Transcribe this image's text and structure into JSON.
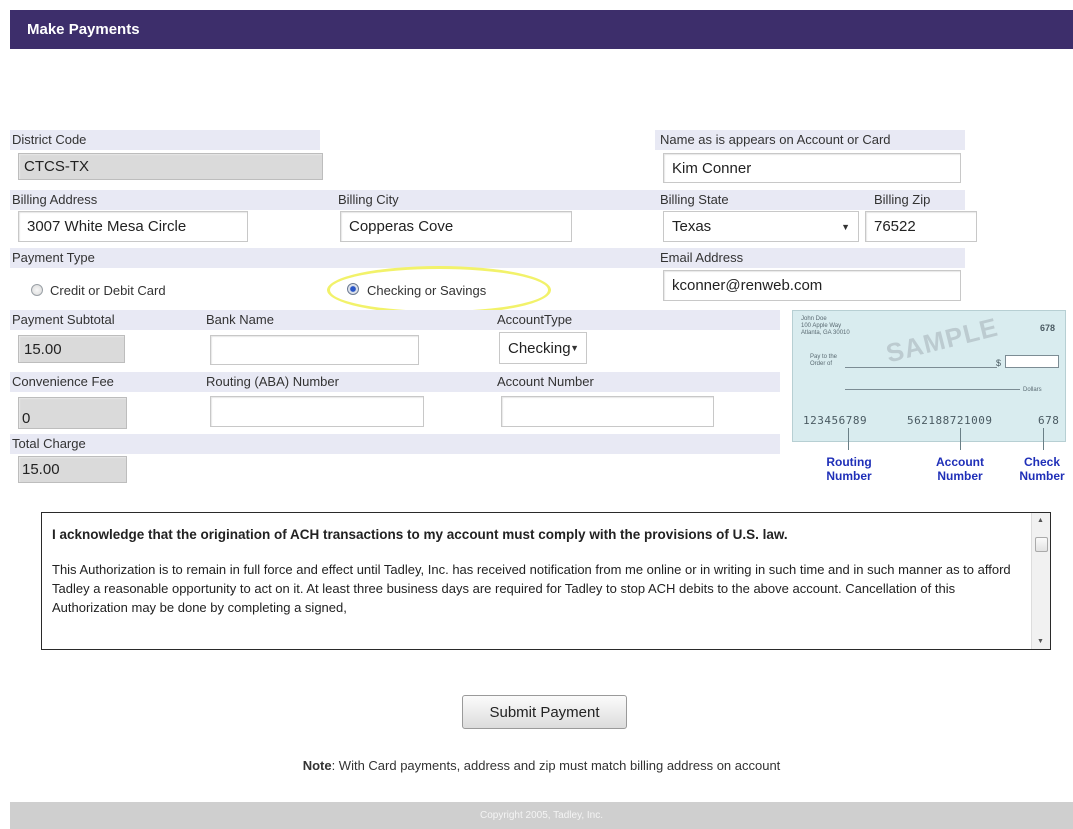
{
  "header": {
    "title": "Make Payments"
  },
  "labels": {
    "district_code": "District Code",
    "name_on_account": "Name as is appears on Account or Card",
    "billing_address": "Billing Address",
    "billing_city": "Billing City",
    "billing_state": "Billing State",
    "billing_zip": "Billing Zip",
    "payment_type": "Payment Type",
    "email_address": "Email Address",
    "payment_subtotal": "Payment Subtotal",
    "bank_name": "Bank Name",
    "account_type": "AccountType",
    "convenience_fee": "Convenience Fee",
    "routing_number": "Routing (ABA) Number",
    "account_number": "Account Number",
    "total_charge": "Total Charge"
  },
  "fields": {
    "district_code": "CTCS-TX",
    "name_on_account": "Kim Conner",
    "billing_address": "3007 White Mesa Circle",
    "billing_city": "Copperas Cove",
    "billing_state": "Texas",
    "billing_zip": "76522",
    "email_address": "kconner@renweb.com",
    "payment_subtotal": "15.00",
    "bank_name": "",
    "account_type": "Checking",
    "convenience_fee": "0",
    "routing_number": "",
    "account_number": "",
    "total_charge": "15.00"
  },
  "payment_type": {
    "options": [
      "Credit or Debit Card",
      "Checking or Savings"
    ],
    "selected": "Checking or Savings"
  },
  "sample_check": {
    "name_lines": [
      "John Doe",
      "100 Apple Way",
      "Atlanta, GA 30010"
    ],
    "check_no": "678",
    "pay_to": "Pay to the",
    "order_of": "Order of",
    "watermark": "SAMPLE",
    "dollar_sign": "$",
    "dollars": "Dollars",
    "routing_digits": "123456789",
    "account_digits": "562188721009",
    "check_digits": "678",
    "legend": {
      "routing_1": "Routing",
      "routing_2": "Number",
      "account_1": "Account",
      "account_2": "Number",
      "check_1": "Check",
      "check_2": "Number"
    }
  },
  "agreement": {
    "heading": "I acknowledge that the origination of ACH transactions to my account must comply with the provisions of U.S. law.",
    "body": "This Authorization is to remain in full force and effect until Tadley, Inc. has received notification from me online or in writing in such time and in such manner as to afford Tadley a reasonable opportunity to act on it. At least three business days are required for Tadley to stop ACH debits to the above account. Cancellation of this Authorization may be done by completing a signed,"
  },
  "actions": {
    "submit_label": "Submit Payment"
  },
  "note": {
    "prefix": "Note",
    "text": ": With Card payments, address and zip must match billing address on account"
  },
  "footer": {
    "copyright": "Copyright 2005, Tadley, Inc."
  },
  "colors": {
    "header_bg": "#3d2e6b",
    "label_row_bg": "#e8e9f4",
    "check_legend": "#1f2fb8",
    "highlight": "#f2f26a"
  }
}
